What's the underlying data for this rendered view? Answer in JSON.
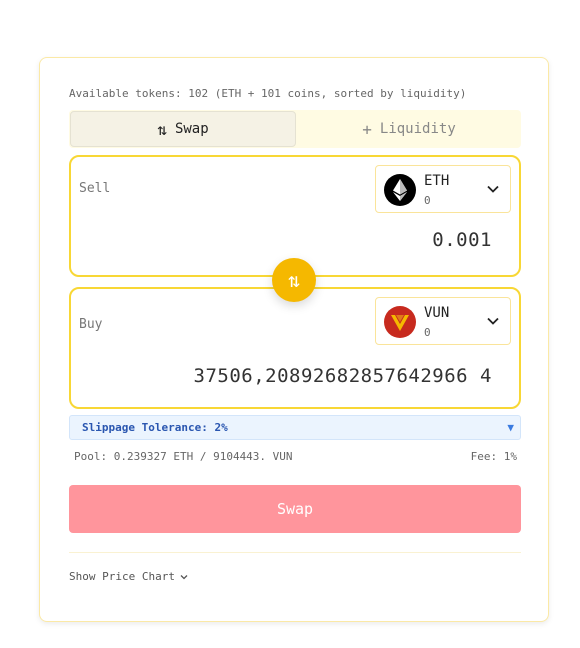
{
  "header": {
    "available": "Available tokens: 102 (ETH + 101 coins, sorted by liquidity)"
  },
  "tabs": [
    {
      "label": "Swap",
      "icon": "swap-arrows-icon",
      "active": true
    },
    {
      "label": "Liquidity",
      "icon": "plus-icon",
      "active": false
    }
  ],
  "sell": {
    "label": "Sell",
    "token": {
      "symbol": "ETH",
      "balance": "0",
      "icon": "ethereum-logo-icon"
    },
    "amount": "0.001"
  },
  "buy": {
    "label": "Buy",
    "token": {
      "symbol": "VUN",
      "balance": "0",
      "icon": "vun-logo-icon"
    },
    "amount": "37506,20892682857642966 4"
  },
  "slippage": {
    "label": "Slippage Tolerance: 2%"
  },
  "pool": {
    "info": "Pool: 0.239327 ETH / 9104443. VUN",
    "fee": "Fee: 1%"
  },
  "swap_button": "Swap",
  "show_chart": "Show Price Chart",
  "colors": {
    "accent": "#f5b800",
    "panel_border": "#f8d735",
    "swap_button": "#ff959c",
    "slippage_bg": "#ebf4fe",
    "vun": "#c72a1e"
  }
}
